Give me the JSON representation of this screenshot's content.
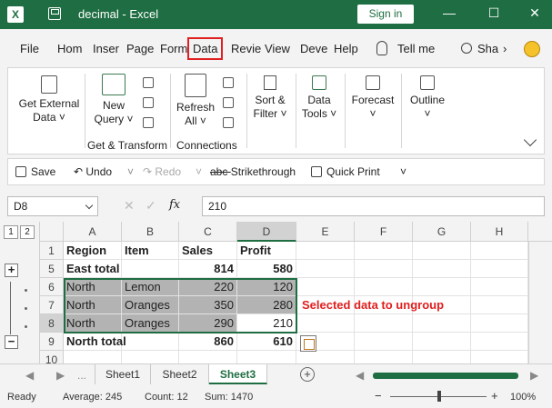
{
  "titlebar": {
    "app_icon": "X",
    "title": "decimal - Excel",
    "signin_label": "Sign in",
    "min_icon": "—",
    "restore_icon": "☐",
    "close_icon": "✕"
  },
  "tabs": {
    "file": "File",
    "home": "Hom",
    "insert": "Inser",
    "page": "Page",
    "formulas": "Form",
    "data": "Data",
    "review": "Revie",
    "view": "View",
    "developer": "Deve",
    "help": "Help",
    "tellme": "Tell me",
    "share": "Sha",
    "more": "›"
  },
  "ribbon": {
    "get_external_l1": "Get External",
    "get_external_l2": "Data ˅",
    "new_query_l1": "New",
    "new_query_l2": "Query ˅",
    "get_transform_label": "Get & Transform",
    "refresh_l1": "Refresh",
    "refresh_l2": "All ˅",
    "connections_label": "Connections",
    "sort_l1": "Sort &",
    "sort_l2": "Filter ˅",
    "datatools_l1": "Data",
    "datatools_l2": "Tools ˅",
    "forecast_l1": "Forecast",
    "forecast_l2": "˅",
    "outline_l1": "Outline",
    "outline_l2": "˅"
  },
  "qat": {
    "save": "Save",
    "undo": "Undo",
    "undo_dd": "˅",
    "redo": "Redo",
    "redo_dd": "˅",
    "strikethrough": "Strikethrough",
    "quickprint": "Quick Print",
    "customize": "˅"
  },
  "formula_bar": {
    "name_box": "D8",
    "cancel": "✕",
    "enter": "✓",
    "fx": "fx",
    "formula": "210"
  },
  "outline": {
    "level1": "1",
    "level2": "2",
    "expand": "+",
    "collapse": "−"
  },
  "columns": [
    "A",
    "B",
    "C",
    "D",
    "E",
    "F",
    "G",
    "H"
  ],
  "rows": [
    {
      "num": "1",
      "cells": [
        "Region",
        "Item",
        "Sales",
        "Profit"
      ]
    },
    {
      "num": "5",
      "cells": [
        "East total",
        "",
        "814",
        "580"
      ]
    },
    {
      "num": "6",
      "cells": [
        "North",
        "Lemon",
        "220",
        "120"
      ]
    },
    {
      "num": "7",
      "cells": [
        "North",
        "Oranges",
        "350",
        "280"
      ]
    },
    {
      "num": "8",
      "cells": [
        "North",
        "Oranges",
        "290",
        "210"
      ]
    },
    {
      "num": "9",
      "cells": [
        "North total",
        "",
        "860",
        "610"
      ]
    },
    {
      "num": "10",
      "cells": [
        "",
        "",
        "",
        ""
      ]
    }
  ],
  "annotation": "Selected data to ungroup",
  "sheets": [
    "Sheet1",
    "Sheet2",
    "Sheet3"
  ],
  "active_sheet": "Sheet3",
  "add_sheet": "+",
  "nav": {
    "prev": "◀",
    "next": "▶",
    "more": "...",
    "scroll_left": "◀",
    "scroll_right": "▶"
  },
  "status": {
    "ready": "Ready",
    "average": "Average: 245",
    "count": "Count: 12",
    "sum": "Sum: 1470",
    "zoom_minus": "−",
    "zoom_plus": "+",
    "zoom": "100%"
  },
  "colors": {
    "excel_green": "#1f6e43",
    "highlight_red": "#e02020",
    "selection_gray": "#b3b3b3"
  }
}
